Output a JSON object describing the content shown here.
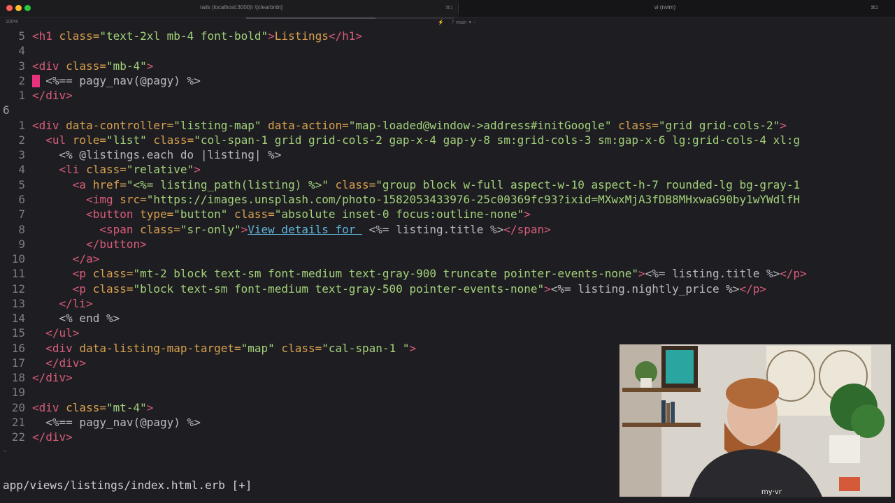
{
  "window": {
    "tab1_title": "rails (localhost:3000)\\ \\[clearbnb\\]",
    "tab1_shortcut": "⌘1",
    "tab2_title": "vi (nvim)",
    "tab2_shortcut": "⌘2"
  },
  "status": {
    "zoom": "100%",
    "branch": "ᚠ main ✦ ◦",
    "scroll_progress": 0.62
  },
  "editor": {
    "cursor_line_number": "6",
    "lines": [
      {
        "num": "5",
        "segments": [
          [
            "t",
            "<h1 "
          ],
          [
            "a",
            "class="
          ],
          [
            "s",
            "\"text-2xl mb-4 font-bold\""
          ],
          [
            "t",
            ">"
          ],
          [
            "a",
            "Listings"
          ],
          [
            "t",
            "</h1>"
          ]
        ]
      },
      {
        "num": "4",
        "segments": []
      },
      {
        "num": "3",
        "segments": [
          [
            "t",
            "<div "
          ],
          [
            "a",
            "class="
          ],
          [
            "s",
            "\"mb-4\""
          ],
          [
            "t",
            ">"
          ]
        ]
      },
      {
        "num": "2",
        "segments": [
          [
            "e",
            "  <%== pagy_nav(@pagy) %>"
          ]
        ]
      },
      {
        "num": "1",
        "segments": [
          [
            "t",
            "</div>"
          ]
        ]
      },
      {
        "num": "6",
        "current": true,
        "segments": []
      },
      {
        "num": "1",
        "segments": [
          [
            "t",
            "<div "
          ],
          [
            "a",
            "data-controller="
          ],
          [
            "s",
            "\"listing-map\""
          ],
          [
            "a",
            " data-action="
          ],
          [
            "s",
            "\"map-loaded@window->address#initGoogle\""
          ],
          [
            "a",
            " class="
          ],
          [
            "s",
            "\"grid grid-cols-2\""
          ],
          [
            "t",
            ">"
          ]
        ]
      },
      {
        "num": "2",
        "segments": [
          [
            "t",
            "  <ul "
          ],
          [
            "a",
            "role="
          ],
          [
            "s",
            "\"list\""
          ],
          [
            "a",
            " class="
          ],
          [
            "s",
            "\"col-span-1 grid grid-cols-2 gap-x-4 gap-y-8 sm:grid-cols-3 sm:gap-x-6 lg:grid-cols-4 xl:g"
          ]
        ]
      },
      {
        "num": "3",
        "segments": [
          [
            "e",
            "    <% @listings.each do |listing| %>"
          ]
        ]
      },
      {
        "num": "4",
        "segments": [
          [
            "t",
            "    <li "
          ],
          [
            "a",
            "class="
          ],
          [
            "s",
            "\"relative\""
          ],
          [
            "t",
            ">"
          ]
        ]
      },
      {
        "num": "5",
        "segments": [
          [
            "t",
            "      <a "
          ],
          [
            "a",
            "href="
          ],
          [
            "s",
            "\"<%= listing_path(listing) %>\""
          ],
          [
            "a",
            " class="
          ],
          [
            "s",
            "\"group block w-full aspect-w-10 aspect-h-7 rounded-lg bg-gray-1"
          ]
        ]
      },
      {
        "num": "6",
        "segments": [
          [
            "t",
            "        <img "
          ],
          [
            "a",
            "src="
          ],
          [
            "s",
            "\"https://images.unsplash.com/photo-1582053433976-25c00369fc93?ixid=MXwxMjA3fDB8MHxwaG90by1wYWdlfH"
          ]
        ]
      },
      {
        "num": "7",
        "segments": [
          [
            "t",
            "        <button "
          ],
          [
            "a",
            "type="
          ],
          [
            "s",
            "\"button\""
          ],
          [
            "a",
            " class="
          ],
          [
            "s",
            "\"absolute inset-0 focus:outline-none\""
          ],
          [
            "t",
            ">"
          ]
        ]
      },
      {
        "num": "8",
        "segments": [
          [
            "t",
            "          <span "
          ],
          [
            "a",
            "class="
          ],
          [
            "s",
            "\"sr-only\""
          ],
          [
            "t",
            ">"
          ],
          [
            "lk",
            "View details for "
          ],
          [
            "e",
            " <%= listing.title %>"
          ],
          [
            "t",
            "</span>"
          ]
        ]
      },
      {
        "num": "9",
        "segments": [
          [
            "t",
            "        </button>"
          ]
        ]
      },
      {
        "num": "10",
        "segments": [
          [
            "t",
            "      </a>"
          ]
        ]
      },
      {
        "num": "11",
        "segments": [
          [
            "t",
            "      <p "
          ],
          [
            "a",
            "class="
          ],
          [
            "s",
            "\"mt-2 block text-sm font-medium text-gray-900 truncate pointer-events-none\""
          ],
          [
            "t",
            ">"
          ],
          [
            "e",
            "<%= listing.title %>"
          ],
          [
            "t",
            "</p>"
          ]
        ]
      },
      {
        "num": "12",
        "segments": [
          [
            "t",
            "      <p "
          ],
          [
            "a",
            "class="
          ],
          [
            "s",
            "\"block text-sm font-medium text-gray-500 pointer-events-none\""
          ],
          [
            "t",
            ">"
          ],
          [
            "e",
            "<%= listing.nightly_price %>"
          ],
          [
            "t",
            "</p>"
          ]
        ]
      },
      {
        "num": "13",
        "segments": [
          [
            "t",
            "    </li>"
          ]
        ]
      },
      {
        "num": "14",
        "segments": [
          [
            "e",
            "    <% end %>"
          ]
        ]
      },
      {
        "num": "15",
        "segments": [
          [
            "t",
            "  </ul>"
          ]
        ]
      },
      {
        "num": "16",
        "segments": [
          [
            "t",
            "  <div "
          ],
          [
            "a",
            "data-listing-map-target="
          ],
          [
            "s",
            "\"map\""
          ],
          [
            "a",
            " class="
          ],
          [
            "s",
            "\"cal-span-1 \""
          ],
          [
            "t",
            ">"
          ]
        ]
      },
      {
        "num": "17",
        "segments": [
          [
            "t",
            "  </div>"
          ]
        ]
      },
      {
        "num": "18",
        "segments": [
          [
            "t",
            "</div>"
          ]
        ]
      },
      {
        "num": "19",
        "segments": []
      },
      {
        "num": "20",
        "segments": [
          [
            "t",
            "<div "
          ],
          [
            "a",
            "class="
          ],
          [
            "s",
            "\"mt-4\""
          ],
          [
            "t",
            ">"
          ]
        ]
      },
      {
        "num": "21",
        "segments": [
          [
            "e",
            "  <%== pagy_nav(@pagy) %>"
          ]
        ]
      },
      {
        "num": "22",
        "segments": [
          [
            "t",
            "</div>"
          ]
        ]
      }
    ]
  },
  "statusline": {
    "filename": "app/views/listings/index.html.erb [+]"
  },
  "webcam": {
    "shirt_logo": "my·vr"
  },
  "colors": {
    "background": "#1e1e22",
    "tag": "#d85c7a",
    "attribute": "#d8a04e",
    "string": "#a3d17a",
    "cursor": "#e8327f"
  }
}
